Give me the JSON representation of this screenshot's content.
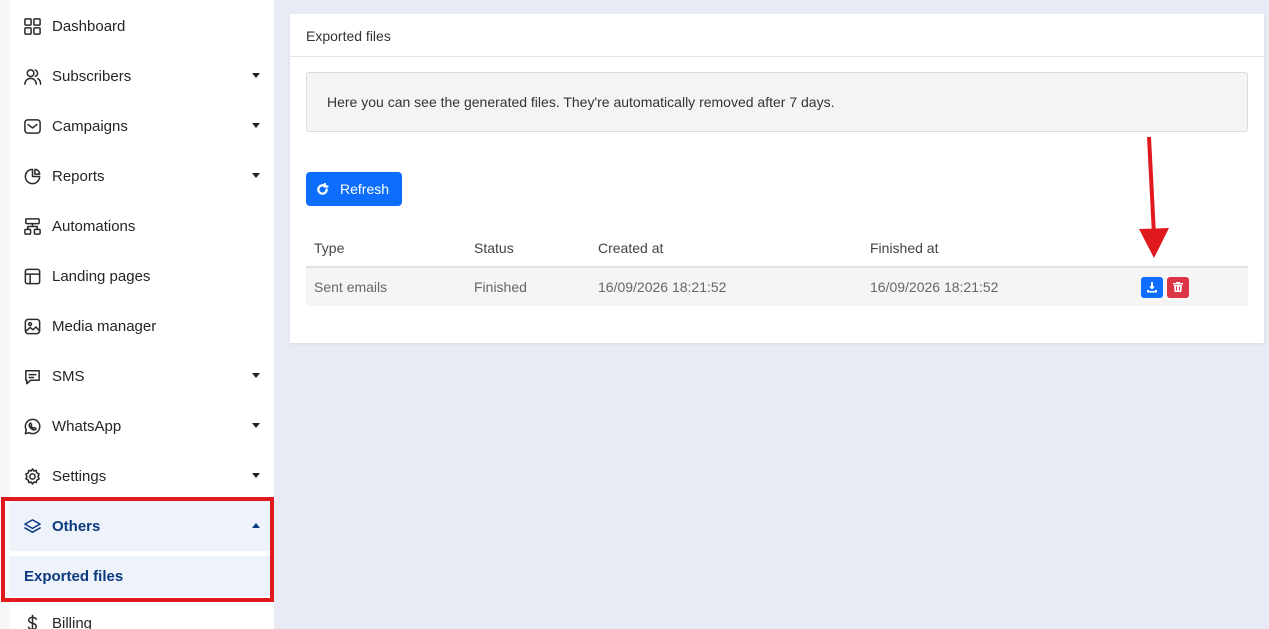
{
  "sidebar": {
    "items": [
      {
        "label": "Dashboard",
        "icon": "dashboard-icon",
        "has_caret": false
      },
      {
        "label": "Subscribers",
        "icon": "users-icon",
        "has_caret": true
      },
      {
        "label": "Campaigns",
        "icon": "mail-icon",
        "has_caret": true
      },
      {
        "label": "Reports",
        "icon": "pie-chart-icon",
        "has_caret": true
      },
      {
        "label": "Automations",
        "icon": "sitemap-icon",
        "has_caret": false
      },
      {
        "label": "Landing pages",
        "icon": "layout-icon",
        "has_caret": false
      },
      {
        "label": "Media manager",
        "icon": "image-icon",
        "has_caret": false
      },
      {
        "label": "SMS",
        "icon": "message-icon",
        "has_caret": true
      },
      {
        "label": "WhatsApp",
        "icon": "whatsapp-icon",
        "has_caret": true
      },
      {
        "label": "Settings",
        "icon": "gear-icon",
        "has_caret": true
      },
      {
        "label": "Others",
        "icon": "layers-icon",
        "has_caret": true,
        "active": true
      },
      {
        "label": "Billing",
        "icon": "dollar-icon",
        "has_caret": false
      }
    ],
    "sub_item": {
      "label": "Exported files",
      "active": true
    }
  },
  "card": {
    "title": "Exported files",
    "info": "Here you can see the generated files. They're automatically removed after 7 days.",
    "refresh_label": "Refresh",
    "table": {
      "headers": [
        "Type",
        "Status",
        "Created at",
        "Finished at",
        ""
      ],
      "rows": [
        {
          "type": "Sent emails",
          "status": "Finished",
          "created_at": "16/09/2026 18:21:52",
          "finished_at": "16/09/2026 18:21:52"
        }
      ]
    }
  },
  "colors": {
    "accent": "#0d6efd",
    "danger": "#dc3545",
    "active_text": "#0b3a7e",
    "annotation": "#e0191f"
  }
}
